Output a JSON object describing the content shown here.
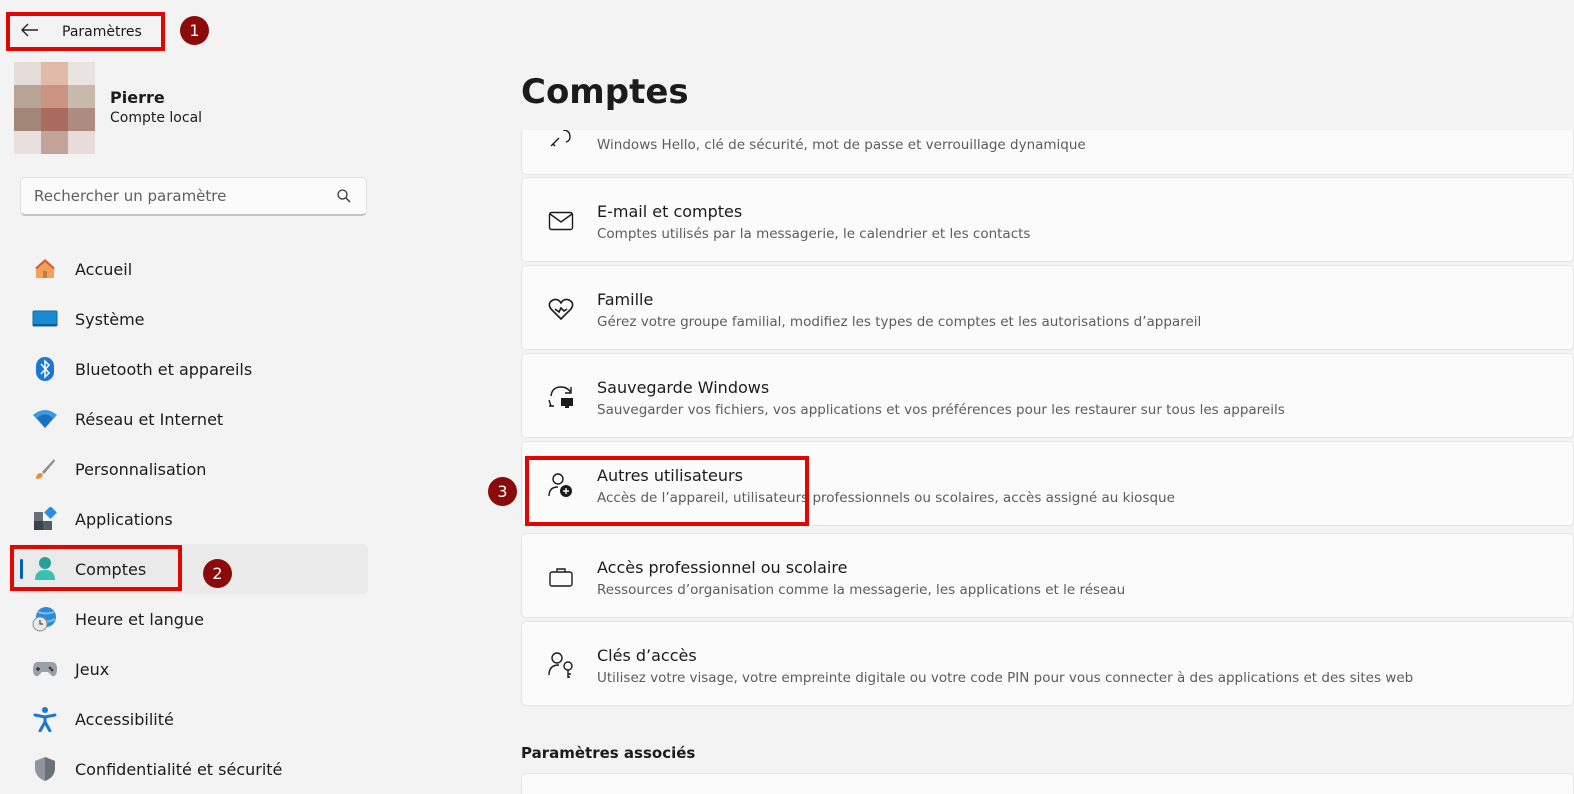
{
  "topbar": {
    "back_title": "Paramètres"
  },
  "annotations": {
    "badge1": "1",
    "badge2": "2",
    "badge3": "3"
  },
  "profile": {
    "name": "Pierre",
    "account_type": "Compte local"
  },
  "search": {
    "placeholder": "Rechercher un paramètre"
  },
  "nav": {
    "items": [
      {
        "label": "Accueil",
        "icon": "home-icon"
      },
      {
        "label": "Système",
        "icon": "system-icon"
      },
      {
        "label": "Bluetooth et appareils",
        "icon": "bluetooth-icon"
      },
      {
        "label": "Réseau et Internet",
        "icon": "wifi-icon"
      },
      {
        "label": "Personnalisation",
        "icon": "brush-icon"
      },
      {
        "label": "Applications",
        "icon": "apps-icon"
      },
      {
        "label": "Comptes",
        "icon": "account-icon",
        "selected": true
      },
      {
        "label": "Heure et langue",
        "icon": "globe-clock-icon"
      },
      {
        "label": "Jeux",
        "icon": "gamepad-icon"
      },
      {
        "label": "Accessibilité",
        "icon": "accessibility-icon"
      },
      {
        "label": "Confidentialité et sécurité",
        "icon": "shield-icon"
      }
    ]
  },
  "main": {
    "title": "Comptes",
    "cards": [
      {
        "title": "",
        "desc": "Windows Hello, clé de sécurité, mot de passe et verrouillage dynamique",
        "icon": "key-icon"
      },
      {
        "title": "E-mail et comptes",
        "desc": "Comptes utilisés par la messagerie, le calendrier et les contacts",
        "icon": "mail-icon"
      },
      {
        "title": "Famille",
        "desc": "Gérez votre groupe familial, modifiez les types de comptes et les autorisations d’appareil",
        "icon": "family-heart-icon"
      },
      {
        "title": "Sauvegarde Windows",
        "desc": "Sauvegarder vos fichiers, vos applications et vos préférences pour les restaurer sur tous les appareils",
        "icon": "backup-icon"
      },
      {
        "title": "Autres utilisateurs",
        "desc": "Accès de l’appareil, utilisateurs professionnels ou scolaires, accès assigné au kiosque",
        "icon": "add-user-icon"
      },
      {
        "title": "Accès professionnel ou scolaire",
        "desc": "Ressources d’organisation comme la messagerie, les applications et le réseau",
        "icon": "briefcase-icon"
      },
      {
        "title": "Clés d’accès",
        "desc": "Utilisez votre visage, votre empreinte digitale ou votre code PIN pour vous connecter à des applications et des sites web",
        "icon": "passkey-icon"
      }
    ],
    "related_label": "Paramètres associés"
  },
  "colors": {
    "highlight_red": "#e10600",
    "badge": "#8b0b0b",
    "accent": "#005fb8"
  }
}
